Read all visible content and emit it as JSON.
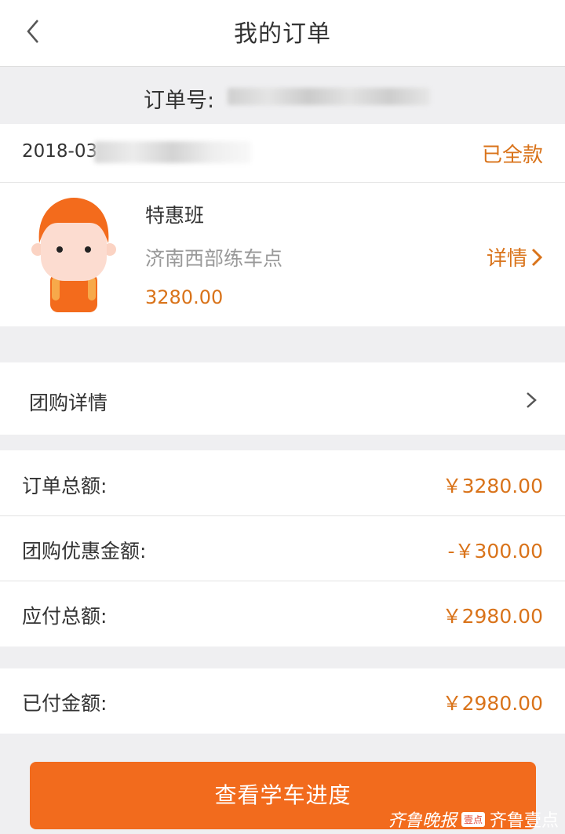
{
  "header": {
    "title": "我的订单"
  },
  "order": {
    "number_label": "订单号:",
    "date_prefix": "2018-03-",
    "status": "已全款"
  },
  "product": {
    "course": "特惠班",
    "location": "济南西部练车点",
    "price": "3280.00",
    "detail_label": "详情"
  },
  "group_buy": {
    "label": "团购详情"
  },
  "summary": {
    "rows": [
      {
        "label": "订单总额:",
        "value": "￥3280.00"
      },
      {
        "label": "团购优惠金额:",
        "value": "-￥300.00"
      },
      {
        "label": "应付总额:",
        "value": "￥2980.00"
      }
    ],
    "paid": {
      "label": "已付金额:",
      "value": "￥2980.00"
    }
  },
  "action": {
    "button_label": "查看学车进度"
  },
  "watermark": {
    "text1": "齐鲁晚报",
    "badge": "壹点",
    "text2": "齐鲁壹点"
  },
  "colors": {
    "accent": "#d9731a",
    "button": "#f26b1d",
    "background": "#efeff1"
  }
}
